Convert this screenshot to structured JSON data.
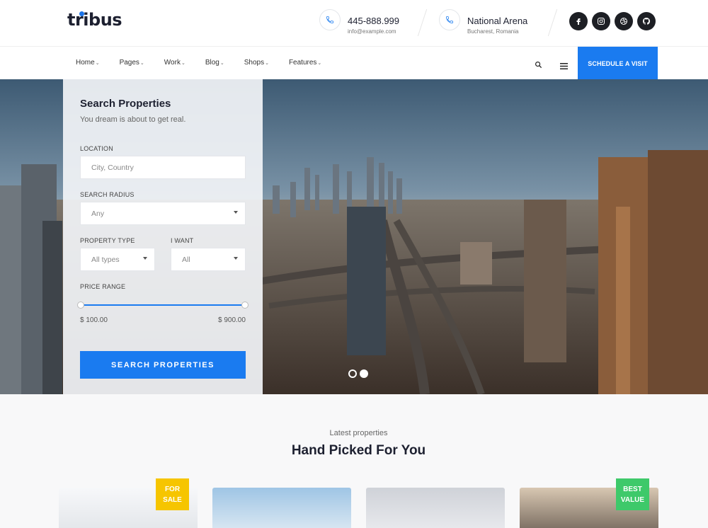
{
  "brand": {
    "logo": "tribus",
    "accent": "#1a7bf0",
    "dark": "#1d1f24"
  },
  "header": {
    "phone": {
      "icon": "phone-icon",
      "title": "445-888.999",
      "subtitle": "info@example.com"
    },
    "location": {
      "icon": "phone-icon",
      "title": "National Arena",
      "subtitle": "Bucharest, Romania"
    },
    "socials": [
      "facebook-icon",
      "instagram-icon",
      "dribbble-icon",
      "github-icon"
    ]
  },
  "nav": {
    "items": [
      {
        "label": "Home"
      },
      {
        "label": "Pages"
      },
      {
        "label": "Work"
      },
      {
        "label": "Blog"
      },
      {
        "label": "Shops"
      },
      {
        "label": "Features"
      }
    ],
    "cta": "SCHEDULE A VISIT"
  },
  "search": {
    "title": "Search Properties",
    "subtitle": "You dream is about to get real.",
    "location_label": "LOCATION",
    "location_placeholder": "City, Country",
    "radius_label": "SEARCH RADIUS",
    "radius_value": "Any",
    "type_label": "PROPERTY TYPE",
    "type_value": "All types",
    "want_label": "I WANT",
    "want_value": "All",
    "price_label": "PRICE RANGE",
    "price_min": "$ 100.00",
    "price_max": "$ 900.00",
    "button": "SEARCH PROPERTIES"
  },
  "carousel": {
    "slides": 2,
    "active": 2
  },
  "properties": {
    "kicker": "Latest properties",
    "title": "Hand Picked For You",
    "badges": [
      {
        "text": "FOR SALE",
        "color": "#f6c500"
      },
      {
        "text": "BEST VALUE",
        "color": "#3ec96a"
      }
    ]
  }
}
